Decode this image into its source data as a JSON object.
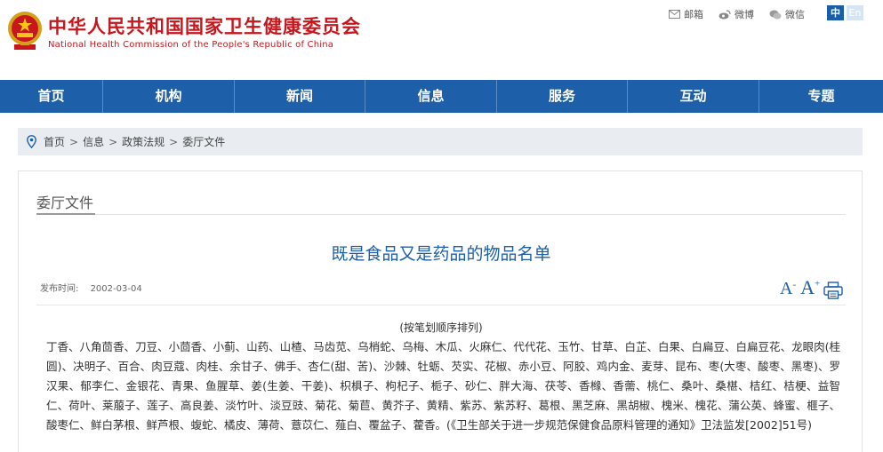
{
  "header": {
    "title_cn": "中华人民共和国国家卫生健康委员会",
    "title_en": "National Health Commission of the People's Republic of China",
    "links": [
      {
        "label": "邮箱",
        "icon": "mail-icon"
      },
      {
        "label": "微博",
        "icon": "weibo-icon"
      },
      {
        "label": "微信",
        "icon": "wechat-icon"
      }
    ],
    "lang_zh": "中",
    "lang_en": "En"
  },
  "nav": {
    "items": [
      {
        "label": "首页"
      },
      {
        "label": "机构"
      },
      {
        "label": "新闻"
      },
      {
        "label": "信息"
      },
      {
        "label": "服务"
      },
      {
        "label": "互动"
      },
      {
        "label": "专题"
      }
    ]
  },
  "breadcrumb": {
    "items": [
      "首页",
      "信息",
      "政策法规",
      "委厅文件"
    ],
    "separator": ">"
  },
  "content": {
    "section_title": "委厅文件",
    "article_title": "既是食品又是药品的物品名单",
    "pub_label": "发布时间:",
    "pub_date": "2002-03-04",
    "font_small": "A",
    "font_large": "A",
    "note": "(按笔划顺序排列)",
    "body": "丁香、八角茴香、刀豆、小茴香、小蓟、山药、山楂、马齿苋、乌梢蛇、乌梅、木瓜、火麻仁、代代花、玉竹、甘草、白芷、白果、白扁豆、白扁豆花、龙眼肉(桂圆)、决明子、百合、肉豆蔻、肉桂、余甘子、佛手、杏仁(甜、苦)、沙棘、牡蛎、芡实、花椒、赤小豆、阿胶、鸡内金、麦芽、昆布、枣(大枣、酸枣、黑枣)、罗汉果、郁李仁、金银花、青果、鱼腥草、姜(生姜、干姜)、枳椇子、枸杞子、栀子、砂仁、胖大海、茯苓、香橼、香薷、桃仁、桑叶、桑椹、桔红、桔梗、益智仁、荷叶、莱菔子、莲子、高良姜、淡竹叶、淡豆豉、菊花、菊苣、黄芥子、黄精、紫苏、紫苏籽、葛根、黑芝麻、黑胡椒、槐米、槐花、蒲公英、蜂蜜、榧子、酸枣仁、鲜白茅根、鲜芦根、蝮蛇、橘皮、薄荷、薏苡仁、薤白、覆盆子、藿香。(《卫生部关于进一步规范保健食品原料管理的通知》卫法监发[2002]51号)"
  },
  "colors": {
    "brand_red": "#c8161d",
    "nav_blue": "#1d5fa8",
    "breadcrumb_bg": "#e9edf2"
  }
}
